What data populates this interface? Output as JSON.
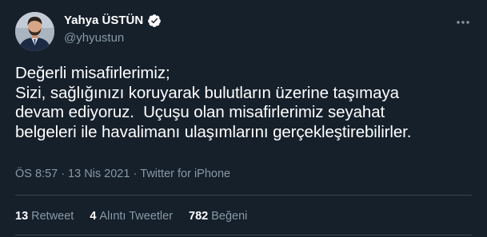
{
  "author": {
    "display_name": "Yahya ÜSTÜN",
    "handle": "@yhyustun",
    "verified": true
  },
  "tweet": {
    "text": "Değerli misafirlerimiz;\nSizi, sağlığınızı koruyarak bulutların üzerine taşımaya\ndevam ediyoruz.  Uçuşu olan misafirlerimiz seyahat\nbelgeleri ile havalimanı ulaşımlarını gerçekleştirebilirler.",
    "time": "ÖS 8:57",
    "separator": "·",
    "date": "13 Nis 2021",
    "source": "Twitter for iPhone"
  },
  "stats": {
    "retweets_count": "13",
    "retweets_label": "Retweet",
    "quotes_count": "4",
    "quotes_label": "Alıntı Tweetler",
    "likes_count": "782",
    "likes_label": "Beğeni"
  },
  "icons": {
    "verified": "verified-badge-icon",
    "more": "more-options-icon"
  },
  "colors": {
    "background": "#15202b",
    "secondary_text": "#8899a6",
    "divider": "#38444d",
    "verified": "#ffffff"
  }
}
